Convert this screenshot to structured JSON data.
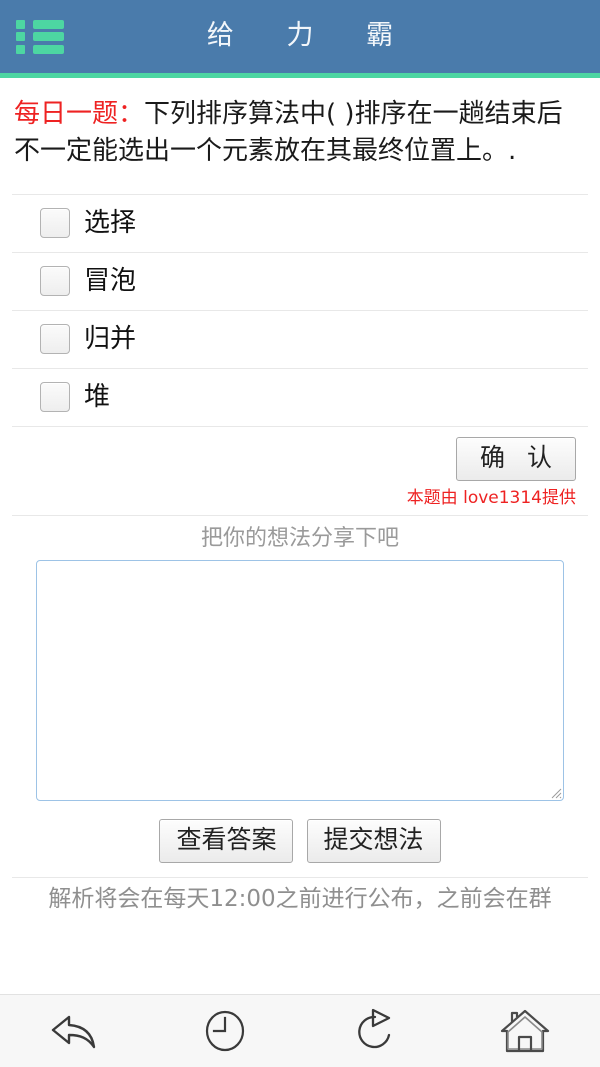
{
  "header": {
    "title": "给 力 霸",
    "menu_icon": "list-menu-icon",
    "bar_color": "#4a7bab",
    "accent_color": "#4dd6a2"
  },
  "question": {
    "label": "每日一题：",
    "text": "下列排序算法中( )排序在一趟结束后不一定能选出一个元素放在其最终位置上。.",
    "label_color": "#ee2222"
  },
  "options": [
    {
      "label": "选择",
      "checked": false
    },
    {
      "label": "冒泡",
      "checked": false
    },
    {
      "label": "归并",
      "checked": false
    },
    {
      "label": "堆",
      "checked": false
    }
  ],
  "confirm": {
    "label": "确 认",
    "credit": "本题由 love1314提供",
    "credit_color": "#ee2222"
  },
  "share": {
    "prompt": "把你的想法分享下吧",
    "textarea_value": "",
    "textarea_placeholder": ""
  },
  "actions": {
    "view_answer": "查看答案",
    "submit_thought": "提交想法"
  },
  "footer": {
    "note": "解析将会在每天12:00之前进行公布，之前会在群"
  },
  "bottom_nav": [
    {
      "icon": "back-arrow-icon"
    },
    {
      "icon": "clock-icon"
    },
    {
      "icon": "refresh-icon"
    },
    {
      "icon": "home-icon"
    }
  ]
}
